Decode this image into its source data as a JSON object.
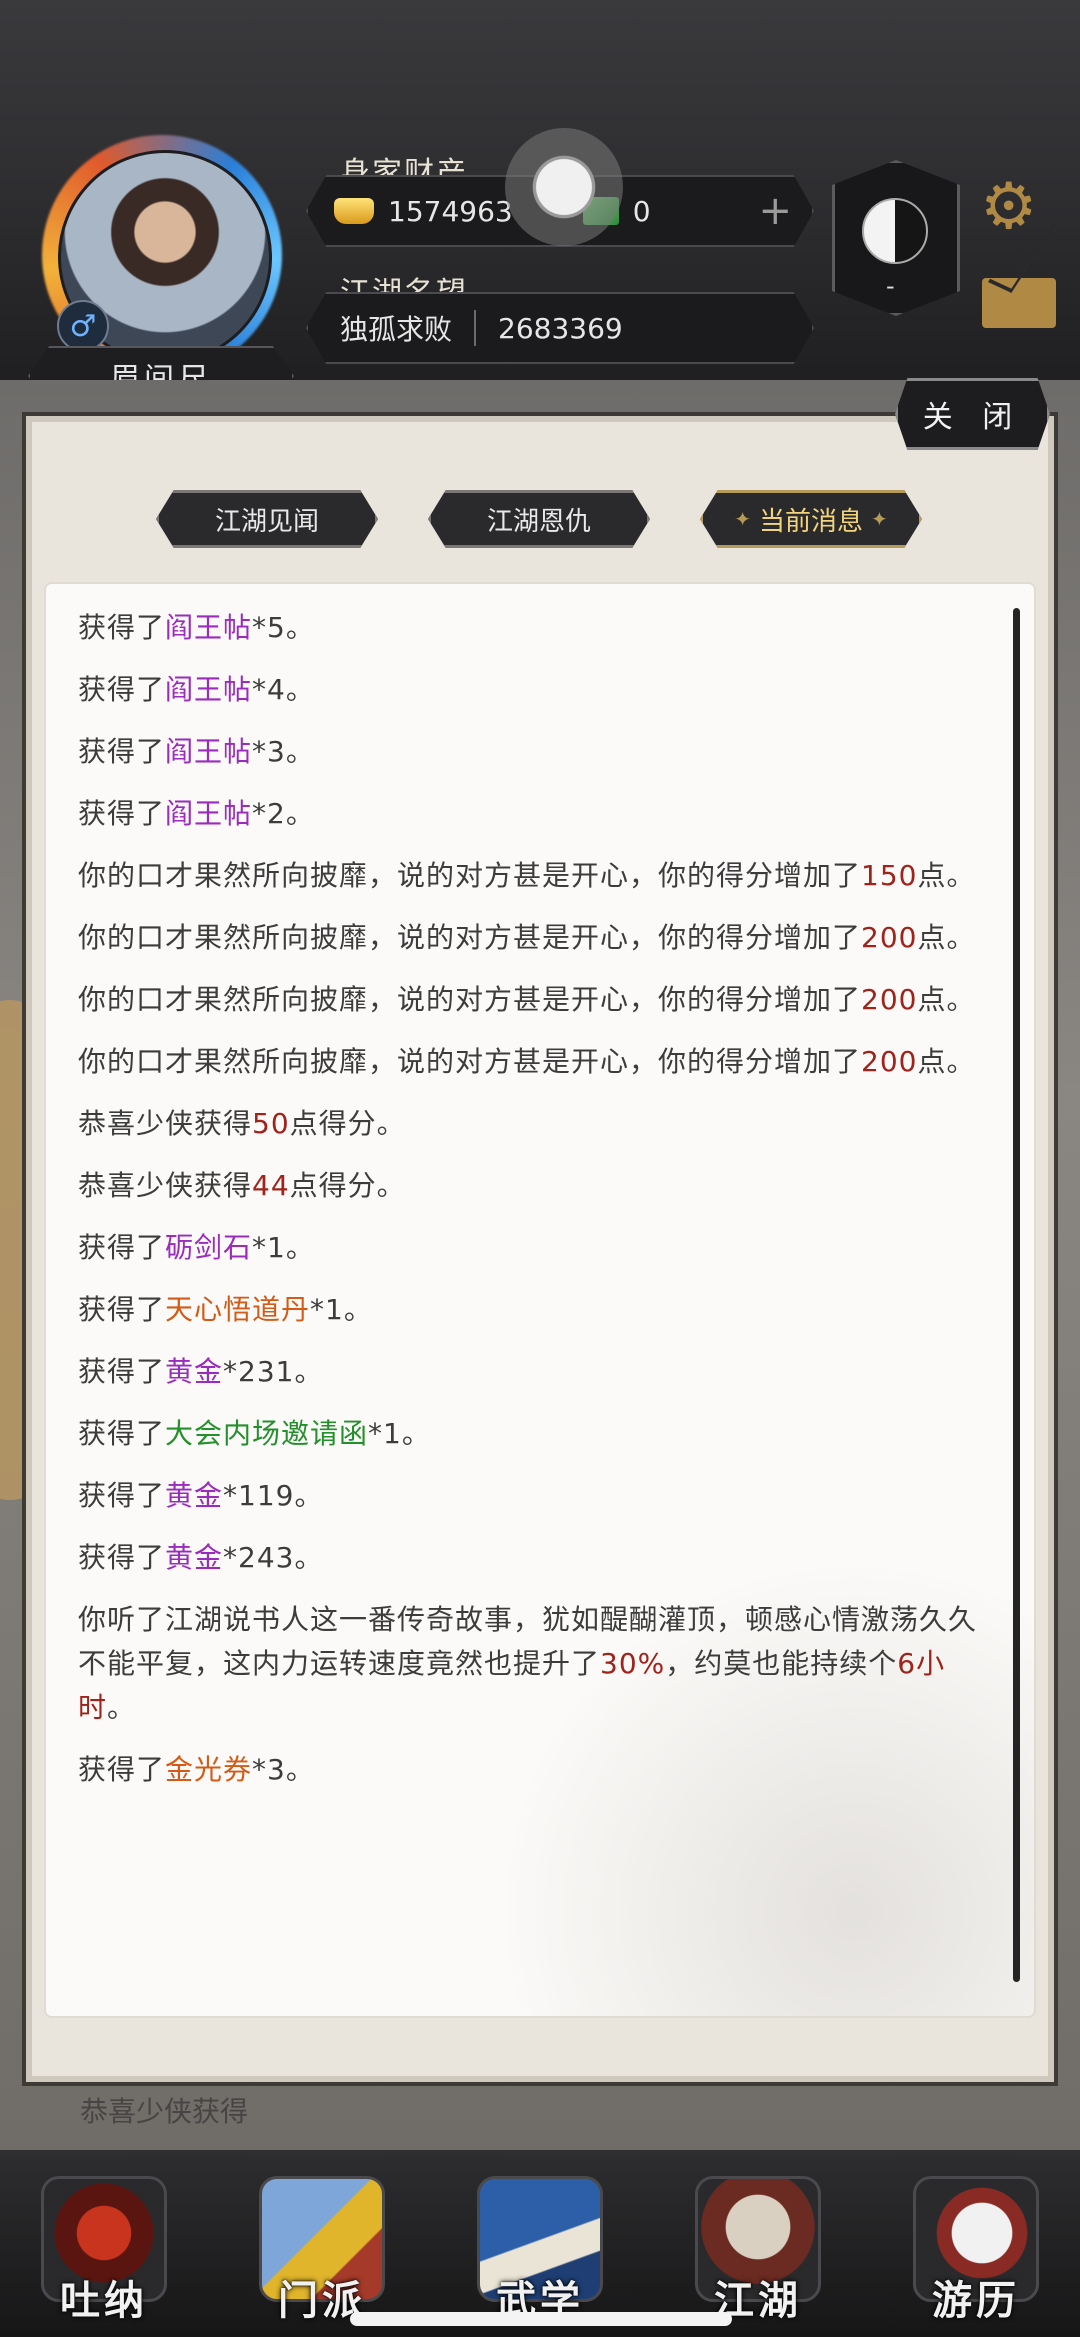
{
  "header": {
    "player_name": "眉间尺",
    "gender_symbol": "♂",
    "wealth_label": "身家财产",
    "gold_amount": "1574963",
    "ticket_amount": "0",
    "add_symbol": "+",
    "reputation_label": "江湖名望",
    "reputation_title": "独孤求败",
    "reputation_value": "2683369",
    "taiji_caption": "-"
  },
  "dialog": {
    "close_label": "关 闭",
    "tabs": [
      {
        "label": "江湖见闻"
      },
      {
        "label": "江湖恩仇"
      },
      {
        "label": "当前消息"
      }
    ],
    "messages": [
      {
        "pre": "获得了",
        "hl": "阎王帖",
        "post": "*5。"
      },
      {
        "pre": "获得了",
        "hl": "阎王帖",
        "post": "*4。"
      },
      {
        "pre": "获得了",
        "hl": "阎王帖",
        "post": "*3。"
      },
      {
        "pre": "获得了",
        "hl": "阎王帖",
        "post": "*2。"
      },
      {
        "pre": "你的口才果然所向披靡，说的对方甚是开心，你的得分增加了",
        "hl": "150",
        "post": "点。"
      },
      {
        "pre": "你的口才果然所向披靡，说的对方甚是开心，你的得分增加了",
        "hl": "200",
        "post": "点。"
      },
      {
        "pre": "你的口才果然所向披靡，说的对方甚是开心，你的得分增加了",
        "hl": "200",
        "post": "点。"
      },
      {
        "pre": "你的口才果然所向披靡，说的对方甚是开心，你的得分增加了",
        "hl": "200",
        "post": "点。"
      },
      {
        "pre": "恭喜少侠获得",
        "hl": "50",
        "post": "点得分。"
      },
      {
        "pre": "恭喜少侠获得",
        "hl": "44",
        "post": "点得分。"
      },
      {
        "pre": "获得了",
        "hl": "砺剑石",
        "post": "*1。"
      },
      {
        "pre": "获得了",
        "hl": "天心悟道丹",
        "post": "*1。"
      },
      {
        "pre": "获得了",
        "hl": "黄金",
        "post": "*231。"
      },
      {
        "pre": "获得了",
        "hl": "大会内场邀请函",
        "post": "*1。"
      },
      {
        "pre": "获得了",
        "hl": "黄金",
        "post": "*119。"
      },
      {
        "pre": "获得了",
        "hl": "黄金",
        "post": "*243。"
      },
      {
        "pre": "你听了江湖说书人这一番传奇故事，犹如醍醐灌顶，顿感心情激荡久久不能平复，这内力运转速度竟然也提升了",
        "hl": "30%",
        "mid": "，约莫也能持续个",
        "hl2": "6小时",
        "post": "。"
      },
      {
        "pre": "获得了",
        "hl": "金光券",
        "post": "*3。"
      }
    ]
  },
  "under_dialog_text": "恭喜少侠获得",
  "bottom_nav": [
    {
      "label": "吐纳",
      "icon": "meditation-icon"
    },
    {
      "label": "门派",
      "icon": "sect-icon"
    },
    {
      "label": "武学",
      "icon": "martial-arts-icon"
    },
    {
      "label": "江湖",
      "icon": "jianghu-icon"
    },
    {
      "label": "游历",
      "icon": "travel-icon"
    }
  ],
  "colors": {
    "item_purple": "#9a2bbd",
    "number_red": "#a0231b",
    "item_orange": "#d35b16",
    "item_green": "#24902c",
    "tab_active_gold": "#f2d47c"
  }
}
